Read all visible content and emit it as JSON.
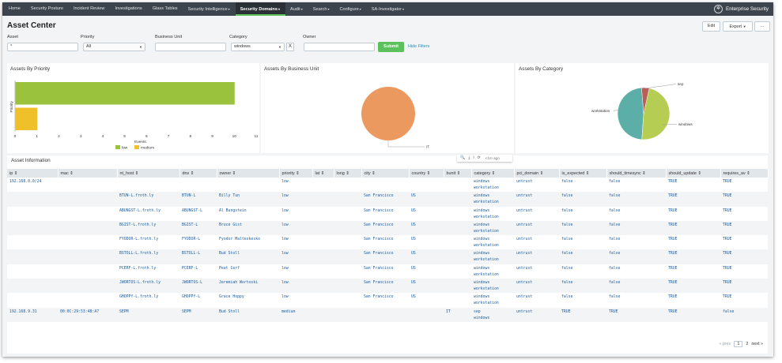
{
  "nav": {
    "items": [
      {
        "label": "Home",
        "caret": ""
      },
      {
        "label": "Security Posture",
        "caret": ""
      },
      {
        "label": "Incident Review",
        "caret": ""
      },
      {
        "label": "Investigations",
        "caret": ""
      },
      {
        "label": "Glass Tables",
        "caret": ""
      },
      {
        "label": "Security Intelligence",
        "caret": "▾"
      },
      {
        "label": "Security Domains",
        "caret": "▾"
      },
      {
        "label": "Audit",
        "caret": "▾"
      },
      {
        "label": "Search",
        "caret": "▾"
      },
      {
        "label": "Configure",
        "caret": "▾"
      },
      {
        "label": "SA-Investigator",
        "caret": "▾"
      }
    ],
    "active_index": 6,
    "brand": "Enterprise Security"
  },
  "page": {
    "title": "Asset Center",
    "edit_label": "Edit",
    "export_label": "Export",
    "more_label": "..."
  },
  "filters": {
    "asset_label": "Asset",
    "asset_value": "*",
    "priority_label": "Priority",
    "priority_value": "All",
    "business_unit_label": "Business Unit",
    "business_unit_value": "",
    "category_label": "Category",
    "category_value": "windows",
    "clear_label": "X",
    "owner_label": "Owner",
    "owner_value": "",
    "submit_label": "Submit",
    "hide_label": "Hide Filters"
  },
  "chart_data": [
    {
      "type": "bar",
      "title": "Assets By Priority",
      "ylabel": "Priority",
      "xlabel": "Events",
      "categories": [
        "low",
        "medium"
      ],
      "values": [
        10,
        1
      ],
      "xlim": [
        0,
        11
      ],
      "xticks": [
        "0",
        "1",
        "2",
        "3",
        "4",
        "5",
        "6",
        "7",
        "8",
        "9",
        "10",
        "11"
      ],
      "legend": [
        {
          "name": "low",
          "color": "#9ac23c"
        },
        {
          "name": "medium",
          "color": "#f0c02a"
        }
      ],
      "legend_position": "bottom"
    },
    {
      "type": "pie",
      "title": "Assets By Business Unit",
      "slices": [
        {
          "label": "IT",
          "value": 1,
          "color": "#ec9960"
        }
      ]
    },
    {
      "type": "pie",
      "title": "Assets By Category",
      "slices": [
        {
          "label": "windows",
          "value": 10,
          "color": "#b5cd52"
        },
        {
          "label": "workstation",
          "value": 10,
          "color": "#5cafa8"
        },
        {
          "label": "sep",
          "value": 1,
          "color": "#b85f59"
        }
      ]
    }
  ],
  "toolbar": {
    "search_icon": "🔍",
    "download_icon": "⤓",
    "info_icon": "i",
    "refresh_icon": "⟳",
    "time_ago": "<1m ago"
  },
  "assets_table": {
    "title": "Asset Information",
    "columns": [
      "ip ⇕",
      "mac ⇕",
      "nt_host ⇕",
      "dns ⇕",
      "owner ⇕",
      "priority ⇕",
      "lat ⇕",
      "long ⇕",
      "city ⇕",
      "country ⇕",
      "bunit ⇕",
      "category ⇕",
      "pci_domain ⇕",
      "is_expected ⇕",
      "should_timesync ⇕",
      "should_update ⇕",
      "requires_av ⇕"
    ],
    "rows": [
      {
        "ip": "192.168.0.0/24",
        "mac": "",
        "nt_host": "",
        "dns": "",
        "owner": "",
        "priority": "low",
        "lat": "",
        "long": "",
        "city": "",
        "country": "",
        "bunit": "",
        "category": "windows\nworkstation",
        "pci_domain": "untrust",
        "is_expected": "false",
        "should_timesync": "false",
        "should_update": "TRUE",
        "requires_av": "TRUE"
      },
      {
        "ip": "",
        "mac": "",
        "nt_host": "BTUN-L.froth.ly",
        "dns": "BTUN-L",
        "owner": "Billy Tun",
        "priority": "low",
        "lat": "",
        "long": "",
        "city": "San Francisco",
        "country": "US",
        "bunit": "",
        "category": "windows\nworkstation",
        "pci_domain": "untrust",
        "is_expected": "false",
        "should_timesync": "false",
        "should_update": "TRUE",
        "requires_av": "TRUE"
      },
      {
        "ip": "",
        "mac": "",
        "nt_host": "ABUNGST-L.froth.ly",
        "dns": "ABUNGST-L",
        "owner": "Al Bungstein",
        "priority": "low",
        "lat": "",
        "long": "",
        "city": "San Francisco",
        "country": "US",
        "bunit": "",
        "category": "windows\nworkstation",
        "pci_domain": "untrust",
        "is_expected": "false",
        "should_timesync": "false",
        "should_update": "TRUE",
        "requires_av": "TRUE"
      },
      {
        "ip": "",
        "mac": "",
        "nt_host": "BGIST-L.froth.ly",
        "dns": "BGIST-L",
        "owner": "Bruce Gist",
        "priority": "low",
        "lat": "",
        "long": "",
        "city": "San Francisco",
        "country": "US",
        "bunit": "",
        "category": "windows\nworkstation",
        "pci_domain": "untrust",
        "is_expected": "false",
        "should_timesync": "false",
        "should_update": "TRUE",
        "requires_av": "TRUE"
      },
      {
        "ip": "",
        "mac": "",
        "nt_host": "FYODOR-L.froth.ly",
        "dns": "FYODOR-L",
        "owner": "Fyodor Malteskesko",
        "priority": "low",
        "lat": "",
        "long": "",
        "city": "San Francisco",
        "country": "US",
        "bunit": "",
        "category": "windows\nworkstation",
        "pci_domain": "untrust",
        "is_expected": "false",
        "should_timesync": "false",
        "should_update": "TRUE",
        "requires_av": "TRUE"
      },
      {
        "ip": "",
        "mac": "",
        "nt_host": "BSTOLL-L.froth.ly",
        "dns": "BSTOLL-L",
        "owner": "Bud Stoll",
        "priority": "low",
        "lat": "",
        "long": "",
        "city": "San Francisco",
        "country": "US",
        "bunit": "",
        "category": "windows\nworkstation",
        "pci_domain": "untrust",
        "is_expected": "false",
        "should_timesync": "false",
        "should_update": "TRUE",
        "requires_av": "TRUE"
      },
      {
        "ip": "",
        "mac": "",
        "nt_host": "PCERF-L.froth.ly",
        "dns": "PCERF-L",
        "owner": "Peat Cerf",
        "priority": "low",
        "lat": "",
        "long": "",
        "city": "San Francisco",
        "country": "US",
        "bunit": "",
        "category": "windows\nworkstation",
        "pci_domain": "untrust",
        "is_expected": "false",
        "should_timesync": "false",
        "should_update": "TRUE",
        "requires_av": "TRUE"
      },
      {
        "ip": "",
        "mac": "",
        "nt_host": "JWORTOS-L.froth.ly",
        "dns": "JWORTOS-L",
        "owner": "Jeremiah Wortoski",
        "priority": "low",
        "lat": "",
        "long": "",
        "city": "San Francisco",
        "country": "US",
        "bunit": "",
        "category": "windows\nworkstation",
        "pci_domain": "untrust",
        "is_expected": "false",
        "should_timesync": "false",
        "should_update": "TRUE",
        "requires_av": "TRUE"
      },
      {
        "ip": "",
        "mac": "",
        "nt_host": "GHOPPY-L.froth.ly",
        "dns": "GHOPPY-L",
        "owner": "Grace Hoppy",
        "priority": "low",
        "lat": "",
        "long": "",
        "city": "San Francisco",
        "country": "US",
        "bunit": "",
        "category": "windows\nworkstation",
        "pci_domain": "untrust",
        "is_expected": "false",
        "should_timesync": "false",
        "should_update": "TRUE",
        "requires_av": "TRUE"
      },
      {
        "ip": "192.168.9.31",
        "mac": "00:0C:29:53:48:A7",
        "nt_host": "SEPM",
        "dns": "SEPM",
        "owner": "Bud Stoll",
        "priority": "medium",
        "lat": "",
        "long": "",
        "city": "",
        "country": "",
        "bunit": "IT",
        "category": "sep\nwindows",
        "pci_domain": "untrust",
        "is_expected": "TRUE",
        "should_timesync": "TRUE",
        "should_update": "TRUE",
        "requires_av": "false"
      }
    ]
  },
  "pagination": {
    "prev": "« prev",
    "pages": [
      "1",
      "2"
    ],
    "current": "1",
    "next": "next »"
  }
}
